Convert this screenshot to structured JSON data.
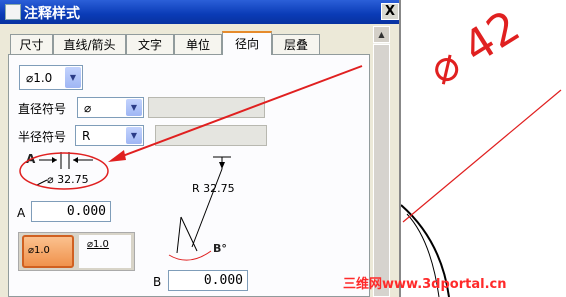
{
  "window": {
    "title": "注释样式",
    "close_label": "X"
  },
  "tabs": [
    {
      "label": "尺寸",
      "active": false
    },
    {
      "label": "直线/箭头",
      "active": false
    },
    {
      "label": "文字",
      "active": false
    },
    {
      "label": "单位",
      "active": false
    },
    {
      "label": "径向",
      "active": true
    },
    {
      "label": "层叠",
      "active": false
    }
  ],
  "radial": {
    "display_format": "⌀1.0",
    "diameter_symbol_label": "直径符号",
    "diameter_symbol_value": "⌀",
    "radius_symbol_label": "半径符号",
    "radius_symbol_value": "R",
    "preview_dim_label": "A",
    "preview_dim_text": "⌀   32.75",
    "field_a_label": "A",
    "field_a_value": "0.000",
    "format_option_1": "⌀1.0",
    "format_option_2": "⌀1.0",
    "radius_preview_text": "R 32.75",
    "angle_label": "B°",
    "field_b_label": "B",
    "field_b_value": "0.000"
  },
  "drawing": {
    "dimension_text": "⌀ 42"
  },
  "watermark": {
    "text": "三维网www.3dportal.cn"
  },
  "colors": {
    "accent": "#e02020",
    "titlebar": "#0a3bb6",
    "dialog_bg": "#ece9d8"
  }
}
